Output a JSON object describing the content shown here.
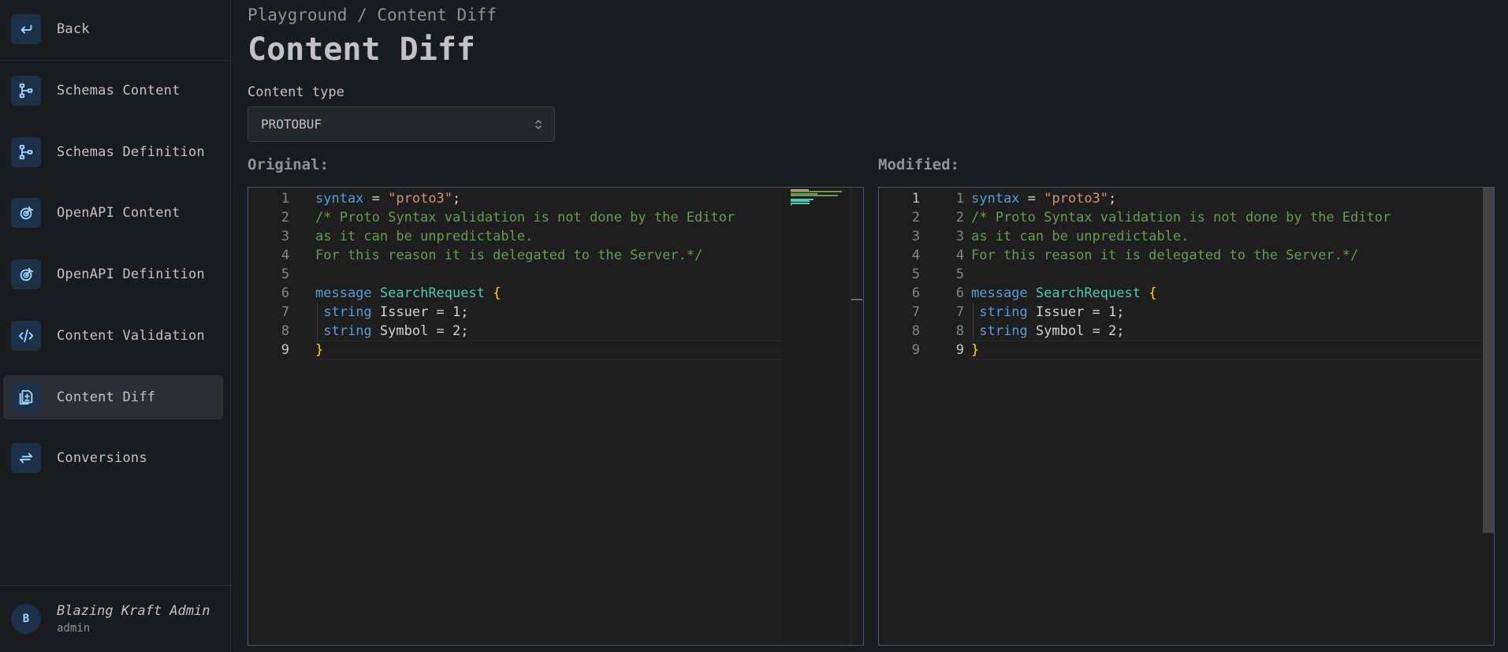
{
  "sidebar": {
    "back_label": "Back",
    "items": [
      {
        "label": "Schemas Content",
        "icon": "schema-icon",
        "active": false
      },
      {
        "label": "Schemas Definition",
        "icon": "schema-icon",
        "active": false
      },
      {
        "label": "OpenAPI Content",
        "icon": "openapi-icon",
        "active": false
      },
      {
        "label": "OpenAPI Definition",
        "icon": "openapi-icon",
        "active": false
      },
      {
        "label": "Content Validation",
        "icon": "code-icon",
        "active": false
      },
      {
        "label": "Content Diff",
        "icon": "file-diff-icon",
        "active": true
      },
      {
        "label": "Conversions",
        "icon": "arrows-exchange-icon",
        "active": false
      }
    ],
    "user": {
      "avatar_initial": "B",
      "name": "Blazing Kraft Admin",
      "role": "admin"
    }
  },
  "main": {
    "breadcrumb": "Playground / Content Diff",
    "title": "Content Diff",
    "content_type_label": "Content type",
    "content_type_value": "PROTOBUF",
    "original_label": "Original:",
    "modified_label": "Modified:"
  },
  "colors": {
    "accent_icon": "#a5d8ff",
    "icon_bg": "#1c3148",
    "keyword": "#569cd6",
    "string": "#ce9178",
    "comment": "#6a9955",
    "type": "#4ec9b0",
    "bracket": "#ffd700"
  },
  "editor": {
    "lines": [
      {
        "n": "1",
        "code": "syntax = \"proto3\";"
      },
      {
        "n": "2",
        "code": "/* Proto Syntax validation is not done by the Editor"
      },
      {
        "n": "3",
        "code": "as it can be unpredictable."
      },
      {
        "n": "4",
        "code": "For this reason it is delegated to the Server.*/"
      },
      {
        "n": "5",
        "code": ""
      },
      {
        "n": "6",
        "code": "message SearchRequest {"
      },
      {
        "n": "7",
        "code": " string Issuer = 1;"
      },
      {
        "n": "8",
        "code": " string Symbol = 2;"
      },
      {
        "n": "9",
        "code": "}"
      }
    ]
  }
}
